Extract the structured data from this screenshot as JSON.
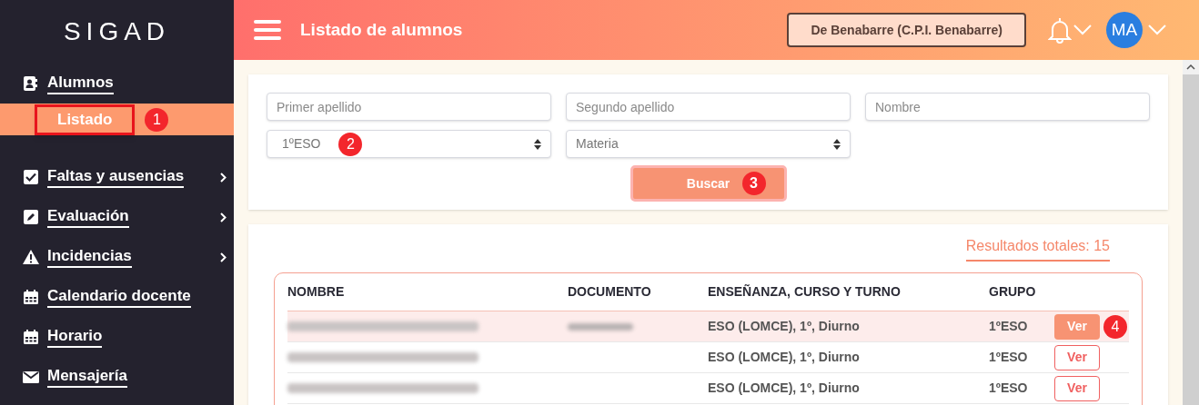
{
  "sidebar": {
    "logo": "SIGAD",
    "items": [
      {
        "label": "Alumnos",
        "expandable": false,
        "children": [
          {
            "label": "Listado",
            "selected": true,
            "callout": "1"
          }
        ]
      },
      {
        "label": "Faltas y ausencias",
        "expandable": true
      },
      {
        "label": "Evaluación",
        "expandable": true
      },
      {
        "label": "Incidencias",
        "expandable": true
      },
      {
        "label": "Calendario docente",
        "expandable": false
      },
      {
        "label": "Horario",
        "expandable": false
      },
      {
        "label": "Mensajería",
        "expandable": false
      }
    ]
  },
  "header": {
    "title": "Listado de alumnos",
    "center_button": "De Benabarre (C.P.I. Benabarre)",
    "avatar": "MA"
  },
  "filters": {
    "fields": [
      {
        "kind": "input",
        "placeholder": "Primer apellido"
      },
      {
        "kind": "input",
        "placeholder": "Segundo apellido"
      },
      {
        "kind": "input",
        "placeholder": "Nombre"
      },
      {
        "kind": "select",
        "value": "1ºESO",
        "callout": "2"
      },
      {
        "kind": "select",
        "placeholder": "Materia"
      }
    ],
    "search_button": {
      "label": "Buscar",
      "callout": "3"
    }
  },
  "results": {
    "total": "Resultados totales: 15",
    "columns": [
      "NOMBRE",
      "DOCUMENTO",
      "ENSEÑANZA, CURSO Y TURNO",
      "GRUPO"
    ],
    "rows": [
      {
        "name_blurred": true,
        "document_blurred": true,
        "course": "ESO (LOMCE), 1º, Diurno",
        "group": "1ºESO",
        "action": "Ver",
        "selected": true,
        "callout": "4"
      },
      {
        "name_blurred": true,
        "document_blurred": false,
        "course": "ESO (LOMCE), 1º, Diurno",
        "group": "1ºESO",
        "action": "Ver",
        "selected": false
      },
      {
        "name_blurred": true,
        "document_blurred": false,
        "course": "ESO (LOMCE), 1º, Diurno",
        "group": "1ºESO",
        "action": "Ver",
        "selected": false
      }
    ]
  }
}
